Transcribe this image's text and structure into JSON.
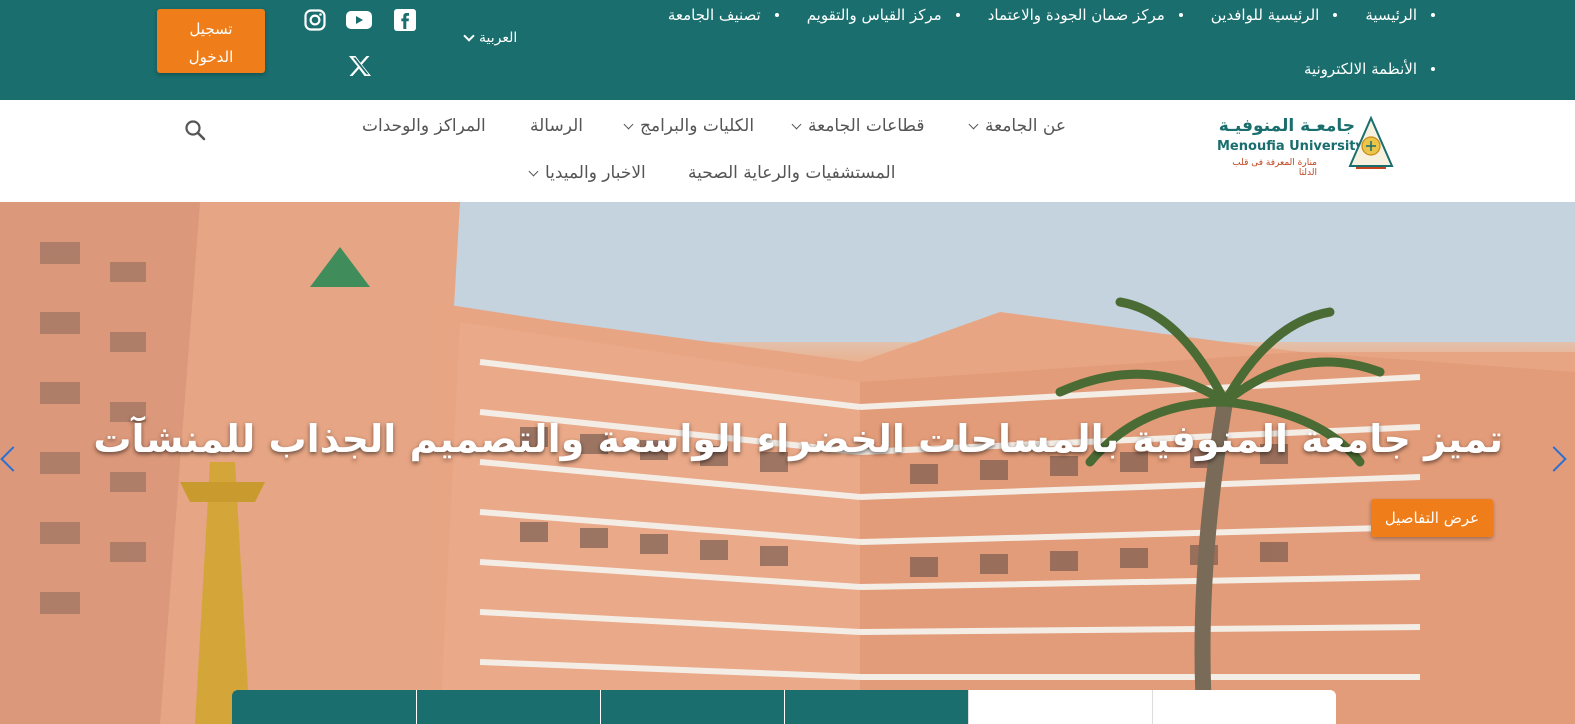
{
  "topbar": {
    "quick_links": [
      {
        "label": "الرئيسية"
      },
      {
        "label": "الرئيسية للوافدين"
      },
      {
        "label": "مركز ضمان الجودة والاعتماد"
      },
      {
        "label": "مركز القياس والتقويم"
      },
      {
        "label": "تصنيف الجامعة"
      },
      {
        "label": "الأنظمة الالكترونية"
      }
    ],
    "language": "العربية",
    "social": [
      "facebook-icon",
      "youtube-icon",
      "instagram-icon",
      "x-icon"
    ],
    "login_line1": "تسجيل",
    "login_line2": "الدخول"
  },
  "logo": {
    "name_ar": "جامعـة المنوفيـة",
    "name_en": "Menoufia University",
    "tagline": "منارة المعرفة فى قلب الدلتا"
  },
  "nav": {
    "items": [
      {
        "label": "عن الجامعة",
        "dropdown": true
      },
      {
        "label": "قطاعات الجامعة",
        "dropdown": true
      },
      {
        "label": "الكليات والبرامج",
        "dropdown": true
      },
      {
        "label": "الرسالة",
        "dropdown": false
      },
      {
        "label": "المراكز والوحدات",
        "dropdown": false
      },
      {
        "label": "المستشفيات والرعاية الصحية",
        "dropdown": false
      },
      {
        "label": "الاخبار والميديا",
        "dropdown": true
      }
    ],
    "search_icon": "search-icon"
  },
  "hero": {
    "title": "تميز جامعة المنوفية بالمساحات الخضراء الواسعة والتصميم الجذاب للمنشآت",
    "button": "عرض التفاصيل",
    "building_sign": "جامعة المنوفية"
  },
  "colors": {
    "primary": "#1a6e6e",
    "accent": "#ef7e1a",
    "nav_text": "#555555"
  }
}
